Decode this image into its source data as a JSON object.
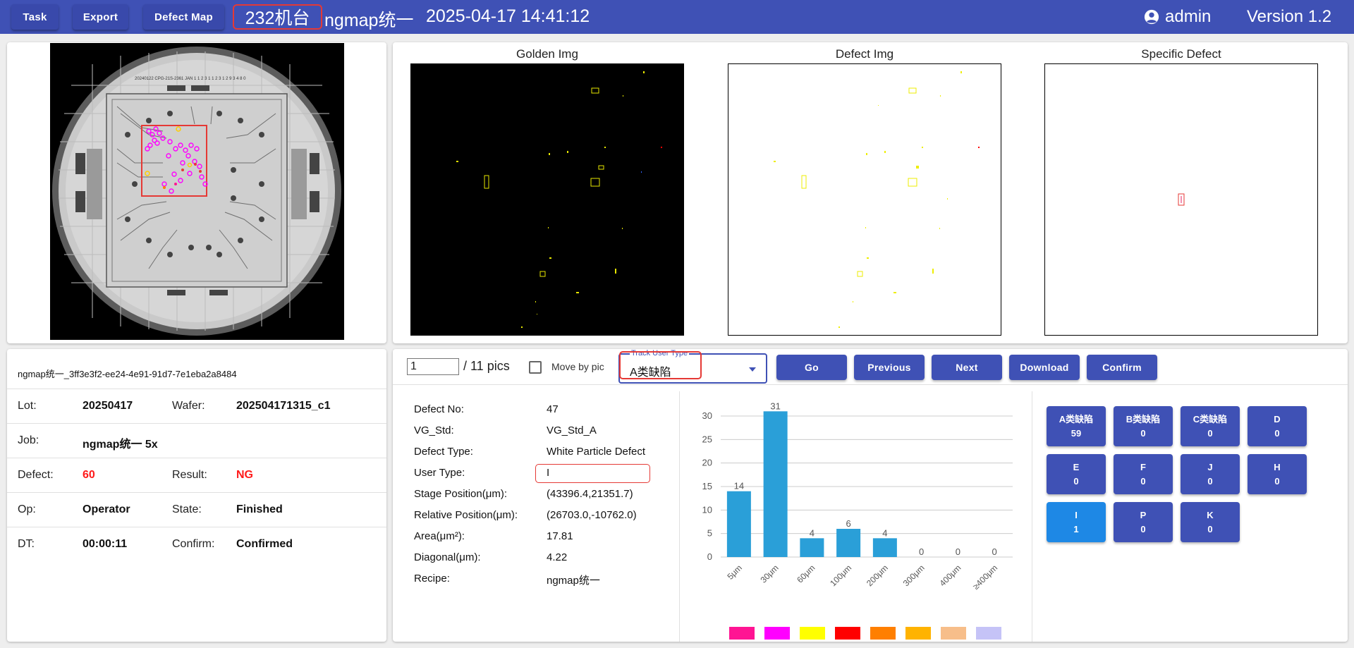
{
  "topbar": {
    "task_label": "Task",
    "export_label": "Export",
    "defect_map_label": "Defect Map",
    "machine": "232机台",
    "title": "ngmap统一",
    "datetime": "2025-04-17 14:41:12",
    "user": "admin",
    "version": "Version 1.2"
  },
  "wafer": {
    "header_text": "20240122 CPG-21S-2361 JAN 1 1 2 3 1 1 2 3 1 2 9 3 4 8 0"
  },
  "images": {
    "golden_title": "Golden Img",
    "defect_title": "Defect Img",
    "specific_title": "Specific Defect"
  },
  "info": {
    "id": "ngmap统一_3ff3e3f2-ee24-4e91-91d7-7e1eba2a8484",
    "lot_label": "Lot:",
    "lot_value": "20250417",
    "wafer_label": "Wafer:",
    "wafer_value": "202504171315_c1",
    "job_label": "Job:",
    "job_value": "ngmap统一 5x",
    "defect_label": "Defect:",
    "defect_value": "60",
    "result_label": "Result:",
    "result_value": "NG",
    "op_label": "Op:",
    "op_value": "Operator",
    "state_label": "State:",
    "state_value": "Finished",
    "dt_label": "DT:",
    "dt_value": "00:00:11",
    "confirm_label": "Confirm:",
    "confirm_value": "Confirmed"
  },
  "controls": {
    "page_value": "1",
    "pics_text": "/ 11 pics",
    "move_by_pic_label": "Move by pic",
    "move_by_pic_checked": false,
    "track_label": "Track User Type",
    "track_value": "A类缺陷",
    "go_label": "Go",
    "previous_label": "Previous",
    "next_label": "Next",
    "download_label": "Download",
    "confirm_label": "Confirm"
  },
  "details": {
    "defect_no_label": "Defect No:",
    "defect_no_value": "47",
    "vg_std_label": "VG_Std:",
    "vg_std_value": "VG_Std_A",
    "defect_type_label": "Defect Type:",
    "defect_type_value": "White Particle Defect",
    "user_type_label": "User Type:",
    "user_type_value": "I",
    "stage_pos_label": "Stage Position(μm):",
    "stage_pos_value": "(43396.4,21351.7)",
    "rel_pos_label": "Relative Position(μm):",
    "rel_pos_value": "(26703.0,-10762.0)",
    "area_label": "Area(μm²):",
    "area_value": "17.81",
    "diagonal_label": "Diagonal(μm):",
    "diagonal_value": "4.22",
    "recipe_label": "Recipe:",
    "recipe_value": "ngmap统一"
  },
  "chart_data": {
    "type": "bar",
    "categories": [
      "5μm",
      "30μm",
      "60μm",
      "100μm",
      "200μm",
      "300μm",
      "400μm",
      "≥400μm"
    ],
    "values": [
      14,
      31,
      4,
      6,
      4,
      0,
      0,
      0
    ],
    "ylim": [
      0,
      30
    ],
    "yticks": [
      0,
      5,
      10,
      15,
      20,
      25,
      30
    ],
    "grid": true,
    "bar_color": "#2a9fd8",
    "legend_colors": [
      "#ff1493",
      "#ff00ff",
      "#ffff00",
      "#ff0000",
      "#ff7f00",
      "#ffb300",
      "#f7be8a",
      "#c5c3f7"
    ]
  },
  "categories_panel": [
    {
      "label": "A类缺陷",
      "count": "59",
      "active": false
    },
    {
      "label": "B类缺陷",
      "count": "0",
      "active": false
    },
    {
      "label": "C类缺陷",
      "count": "0",
      "active": false
    },
    {
      "label": "D",
      "count": "0",
      "active": false
    },
    {
      "label": "E",
      "count": "0",
      "active": false
    },
    {
      "label": "F",
      "count": "0",
      "active": false
    },
    {
      "label": "J",
      "count": "0",
      "active": false
    },
    {
      "label": "H",
      "count": "0",
      "active": false
    },
    {
      "label": "I",
      "count": "1",
      "active": true
    },
    {
      "label": "P",
      "count": "0",
      "active": false
    },
    {
      "label": "K",
      "count": "0",
      "active": false
    }
  ]
}
